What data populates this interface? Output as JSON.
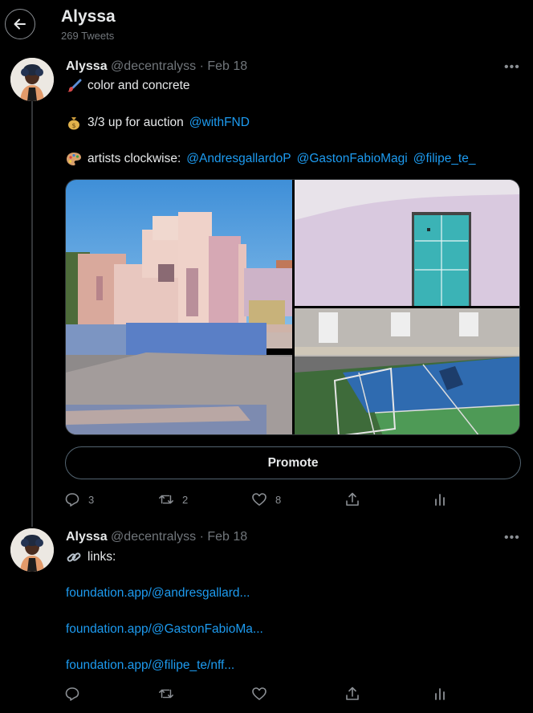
{
  "header": {
    "title": "Alyssa",
    "subtitle": "269 Tweets"
  },
  "tweets": [
    {
      "name": "Alyssa",
      "handle": "@decentralyss",
      "separator": "·",
      "date": "Feb 18",
      "more": "•••",
      "lines": {
        "line1": {
          "emoji": "paintbrush",
          "text": "color and concrete"
        },
        "line2": {
          "emoji": "money-bag",
          "text": "3/3 up for auction",
          "mention": "@withFND"
        },
        "line3": {
          "emoji": "artist-palette",
          "text": "artists clockwise:",
          "mentions": [
            "@AndresgallardoP",
            "@GastonFabioMagi",
            "@filipe_te_"
          ]
        }
      },
      "media": [
        "pink-architecture-photo",
        "turquoise-door-photo",
        "basketball-court-photo"
      ],
      "promote_label": "Promote",
      "actions": {
        "reply": "3",
        "retweet": "2",
        "like": "8"
      }
    },
    {
      "name": "Alyssa",
      "handle": "@decentralyss",
      "separator": "·",
      "date": "Feb 18",
      "more": "•••",
      "lines": {
        "line1": {
          "emoji": "link",
          "text": "links:"
        }
      },
      "links": [
        "foundation.app/@andresgallard...",
        "foundation.app/@GastonFabioMa...",
        "foundation.app/@filipe_te/nff..."
      ],
      "actions": {
        "reply": "",
        "retweet": "",
        "like": ""
      }
    }
  ],
  "colors": {
    "background": "#000000",
    "text": "#e7e9ea",
    "muted": "#71767b",
    "link": "#1d9bf0",
    "border": "#536471"
  }
}
